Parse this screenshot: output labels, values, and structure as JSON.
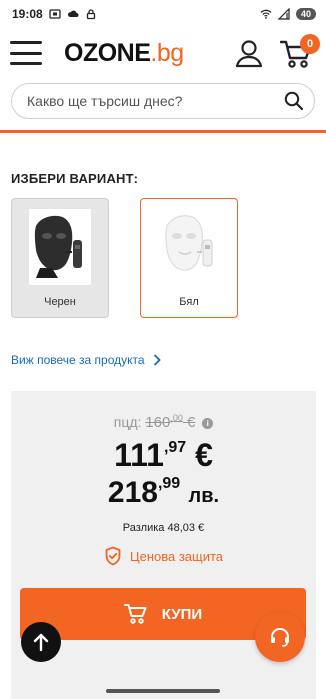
{
  "status_bar": {
    "time": "19:08",
    "battery": "40"
  },
  "header": {
    "logo_main": "OZONE",
    "logo_suffix": ".bg",
    "cart_count": "0"
  },
  "search": {
    "placeholder": "Какво ще търсиш днес?"
  },
  "variants": {
    "title": "ИЗБЕРИ ВАРИАНТ:",
    "items": [
      {
        "label": "Черен",
        "selected": false
      },
      {
        "label": "Бял",
        "selected": true
      }
    ]
  },
  "more_link": "Виж повече за продукта",
  "price": {
    "old_label": "пцд:",
    "old_int": "160",
    "old_dec": ",00",
    "old_currency": "€",
    "main_int": "111",
    "main_dec": ",97",
    "main_currency": "€",
    "bgn_int": "218",
    "bgn_dec": ",99",
    "bgn_currency": "лв.",
    "difference": "Разлика 48,03 €",
    "protection": "Ценова защита"
  },
  "buy_button": "КУПИ",
  "colors": {
    "accent": "#f26522",
    "link": "#1a6bb5"
  }
}
